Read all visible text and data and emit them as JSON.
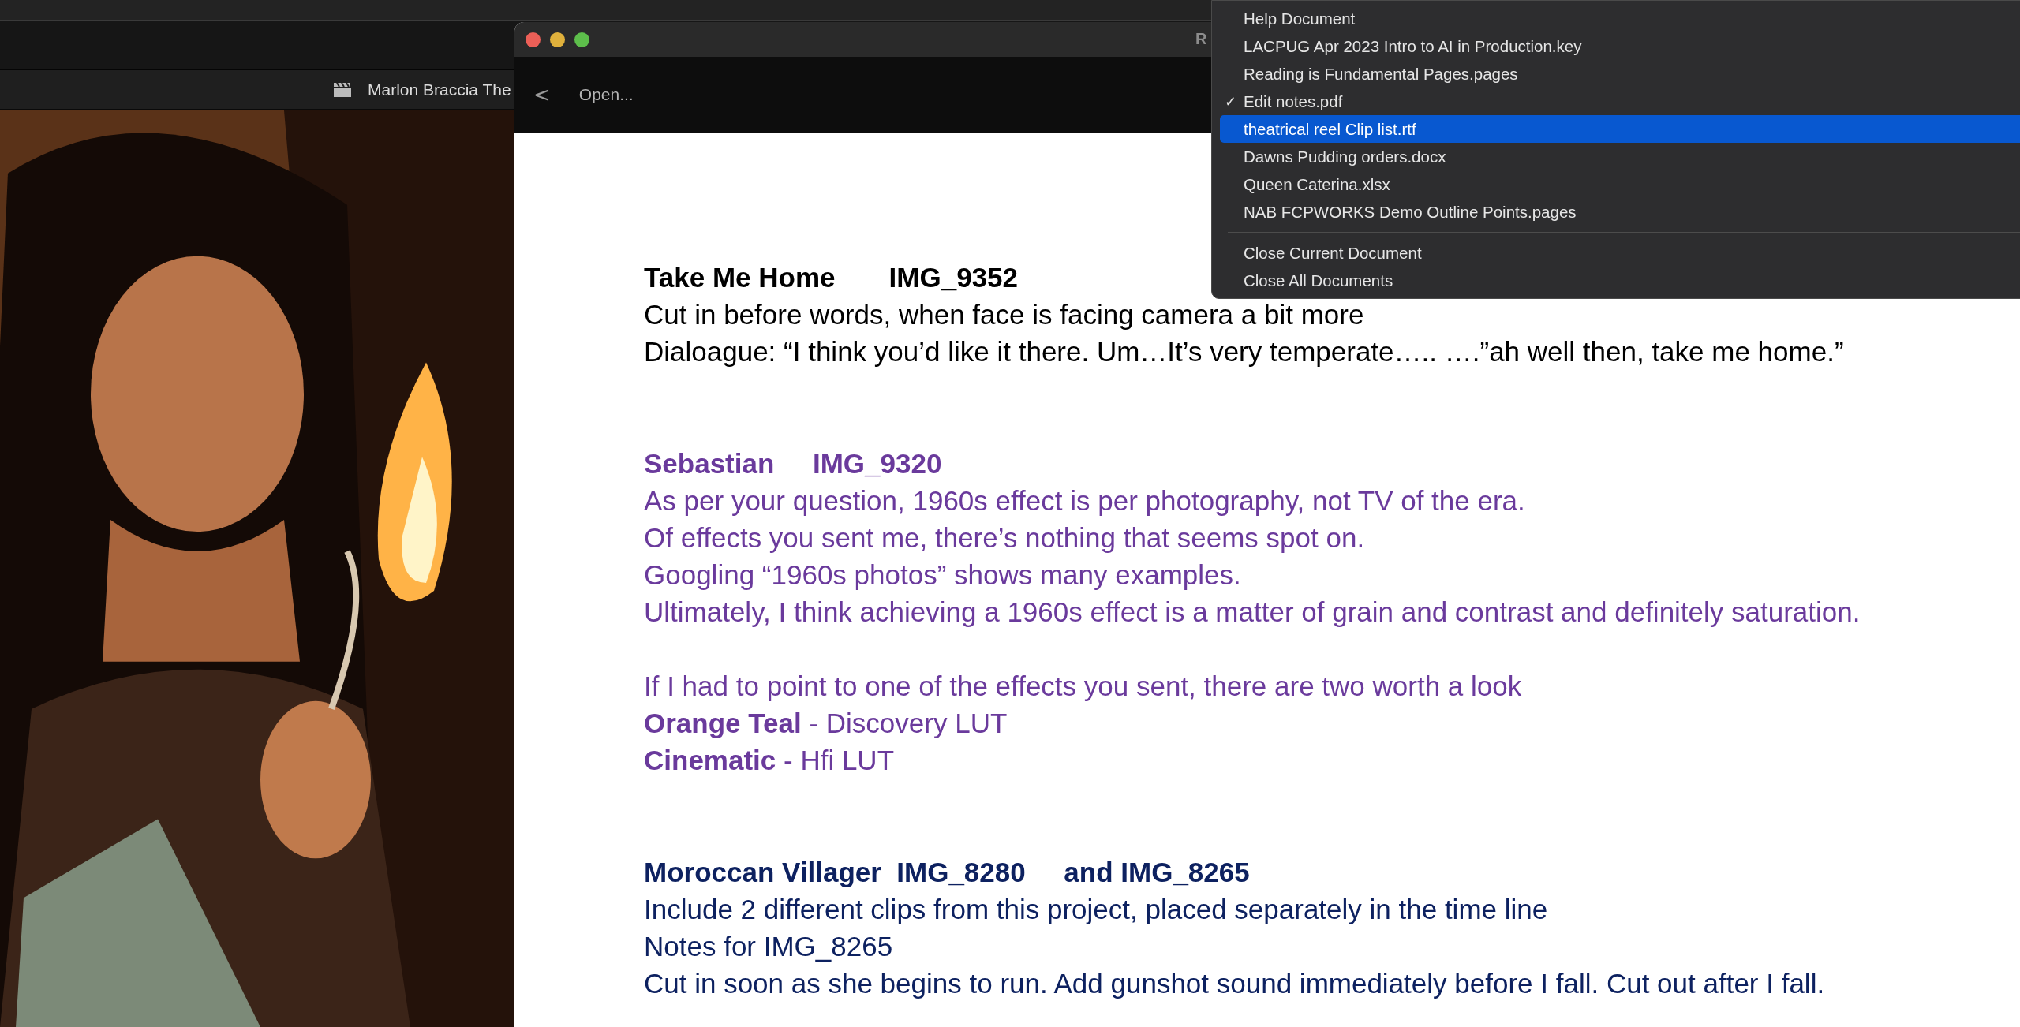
{
  "background_app": {
    "clip_title": "Marlon Braccia The"
  },
  "window": {
    "title": "R",
    "toolbar": {
      "back": "<",
      "open": "Open..."
    },
    "document": {
      "sections": [
        {
          "color": "#000000",
          "heading": "Take Me Home       IMG_9352",
          "paragraphs": [
            [
              "Cut in before words, when face is facing camera a bit more",
              "Dialoague:  “I think you’d like it there. Um…It’s very temperate….. ….”ah well then, take me home.”"
            ]
          ]
        },
        {
          "color": "#6a3a9c",
          "heading": "Sebastian     IMG_9320",
          "paragraphs": [
            [
              "As per your question, 1960s effect is per photography, not TV of the era.",
              "Of effects you sent me, there’s nothing that seems spot on.",
              "Googling “1960s photos” shows many examples.",
              "Ultimately, I think achieving a 1960s effect is a matter of grain and contrast and definitely saturation."
            ],
            [
              "If I had to point to one of the effects you sent, there are two worth a look",
              "**Orange Teal** - Discovery LUT",
              "**Cinematic** - Hfi LUT"
            ]
          ]
        },
        {
          "color": "#0d2160",
          "heading": "Moroccan Villager  IMG_8280     and IMG_8265",
          "paragraphs": [
            [
              "Include 2 different clips from this project, placed separately in the time line",
              "Notes for IMG_8265",
              "Cut in soon as she begins to run.  Add gunshot sound immediately before I fall. Cut out after I fall."
            ]
          ]
        }
      ]
    }
  },
  "menu": {
    "check_mark": "✓",
    "groups": [
      [
        {
          "label": "Help Document",
          "checked": false,
          "selected": false
        },
        {
          "label": "LACPUG Apr 2023 Intro to AI in Production.key",
          "checked": false,
          "selected": false
        },
        {
          "label": "Reading is Fundamental Pages.pages",
          "checked": false,
          "selected": false
        },
        {
          "label": "Edit notes.pdf",
          "checked": true,
          "selected": false
        },
        {
          "label": "theatrical reel Clip list.rtf",
          "checked": false,
          "selected": true
        },
        {
          "label": "Dawns Pudding orders.docx",
          "checked": false,
          "selected": false
        },
        {
          "label": "Queen Caterina.xlsx",
          "checked": false,
          "selected": false
        },
        {
          "label": "NAB FCPWORKS Demo Outline Points.pages",
          "checked": false,
          "selected": false
        }
      ],
      [
        {
          "label": "Close Current Document",
          "checked": false,
          "selected": false
        },
        {
          "label": "Close All Documents",
          "checked": false,
          "selected": false
        }
      ]
    ]
  }
}
